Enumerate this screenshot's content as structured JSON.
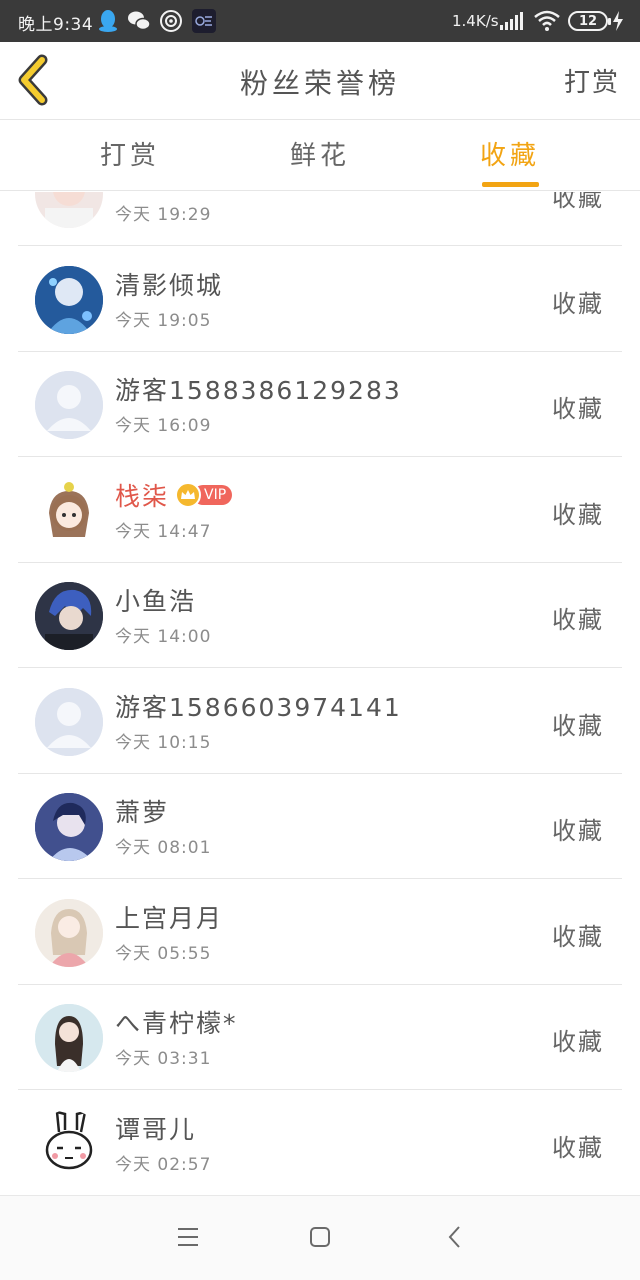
{
  "status_bar": {
    "time": "晚上9:34",
    "speed": "1.4K/s",
    "battery": "12",
    "icons": [
      "qq-icon",
      "wechat-icon",
      "hotspot-icon",
      "app-icon",
      "signal-icon",
      "wifi-icon",
      "battery-icon",
      "charging-icon"
    ]
  },
  "header": {
    "title": "粉丝荣誉榜",
    "right_label": "打赏",
    "back_icon": "chevron-left-icon"
  },
  "tabs": [
    {
      "label": "打赏",
      "active": false
    },
    {
      "label": "鲜花",
      "active": false
    },
    {
      "label": "收藏",
      "active": true
    }
  ],
  "colors": {
    "accent": "#f2a413",
    "vip_name": "#e0574a",
    "back_arrow": "#f5cc2f"
  },
  "rows": [
    {
      "name": "",
      "time": "今天 19:29",
      "action": "收藏",
      "vip": false
    },
    {
      "name": "清影倾城",
      "time": "今天 19:05",
      "action": "收藏",
      "vip": false
    },
    {
      "name": "游客1588386129283",
      "time": "今天 16:09",
      "action": "收藏",
      "vip": false
    },
    {
      "name": "栈柒",
      "time": "今天 14:47",
      "action": "收藏",
      "vip": true,
      "vip_label": "VIP"
    },
    {
      "name": "小鱼浩",
      "time": "今天 14:00",
      "action": "收藏",
      "vip": false
    },
    {
      "name": "游客1586603974141",
      "time": "今天 10:15",
      "action": "收藏",
      "vip": false
    },
    {
      "name": "萧萝",
      "time": "今天 08:01",
      "action": "收藏",
      "vip": false
    },
    {
      "name": "上宫月月",
      "time": "今天 05:55",
      "action": "收藏",
      "vip": false
    },
    {
      "name": "へ青柠檬*",
      "time": "今天 03:31",
      "action": "收藏",
      "vip": false
    },
    {
      "name": "谭哥儿",
      "time": "今天 02:57",
      "action": "收藏",
      "vip": false
    }
  ],
  "nav": [
    "menu-icon",
    "home-icon",
    "back-icon"
  ]
}
